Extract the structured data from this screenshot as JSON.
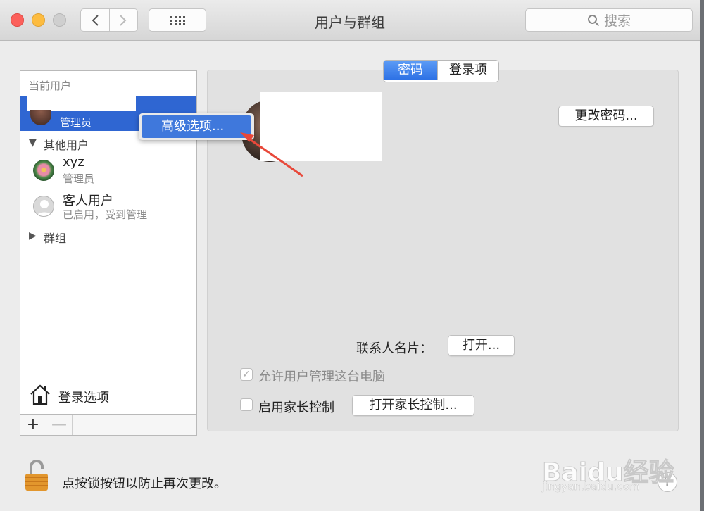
{
  "window": {
    "title": "用户与群组"
  },
  "toolbar": {
    "search_placeholder": "搜索"
  },
  "sidebar": {
    "current_users_label": "当前用户",
    "current_user": {
      "role": "管理员"
    },
    "other_users_label": "其他用户",
    "users": [
      {
        "name": "xyz",
        "role": "管理员"
      },
      {
        "name": "客人用户",
        "role": "已启用，受到管理"
      }
    ],
    "groups_label": "群组",
    "login_options": "登录选项",
    "add_button": "+",
    "remove_button": "—"
  },
  "context_menu": {
    "advanced_options": "高级选项..."
  },
  "tabs": [
    {
      "label": "密码"
    },
    {
      "label": "登录项"
    }
  ],
  "main": {
    "change_password": "更改密码...",
    "contact_card_label": "联系人名片：",
    "open_button": "打开...",
    "allow_admin": "允许用户管理这台电脑",
    "allow_admin_checked": true,
    "parental_controls": "启用家长控制",
    "parental_controls_checked": false,
    "open_parental_controls": "打开家长控制..."
  },
  "footer": {
    "lock_text": "点按锁按钮以防止再次更改。",
    "help": "?"
  },
  "watermark": {
    "main": "Baidu经验",
    "sub": "jingyan.baidu.com"
  }
}
